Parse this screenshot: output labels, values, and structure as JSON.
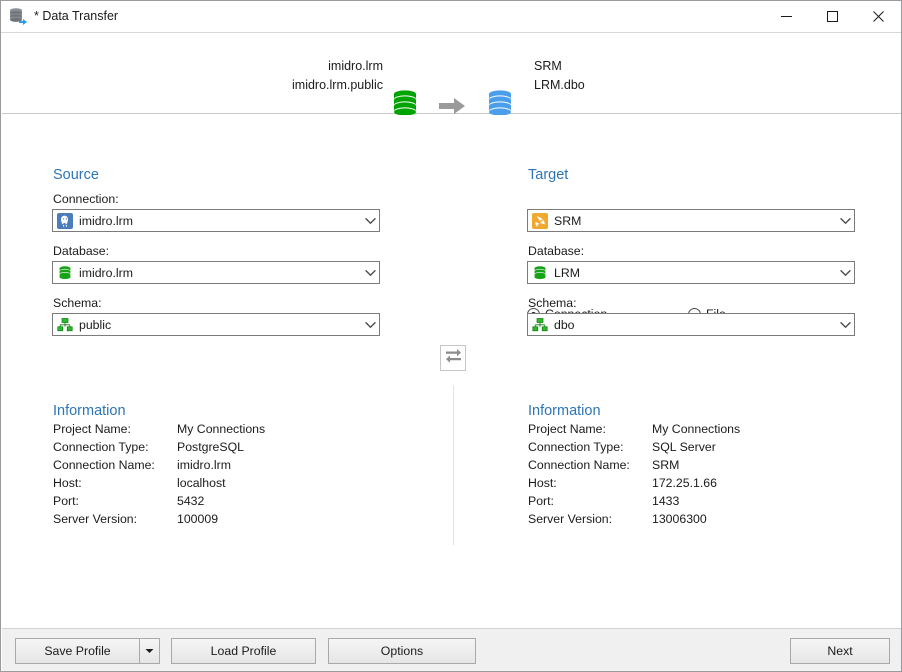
{
  "window": {
    "title": "* Data Transfer",
    "icon": "data-transfer-icon",
    "controls": {
      "minimize": "─",
      "maximize": "□",
      "close": "✕"
    }
  },
  "header": {
    "source_line1": "imidro.lrm",
    "source_line2": "imidro.lrm.public",
    "target_line1": "SRM",
    "target_line2": "LRM.dbo",
    "source_db_color": "#00a400",
    "target_db_color": "#4a9eea",
    "arrow_color": "#9a9a9a"
  },
  "source": {
    "title": "Source",
    "connection_label": "Connection:",
    "connection_value": "imidro.lrm",
    "connection_icon": "postgresql-icon",
    "database_label": "Database:",
    "database_value": "imidro.lrm",
    "database_icon": "database-icon",
    "schema_label": "Schema:",
    "schema_value": "public",
    "schema_icon": "schema-icon",
    "info_title": "Information",
    "info": [
      {
        "key": "Project Name:",
        "value": "My Connections"
      },
      {
        "key": "Connection Type:",
        "value": "PostgreSQL"
      },
      {
        "key": "Connection Name:",
        "value": "imidro.lrm"
      },
      {
        "key": "Host:",
        "value": "localhost"
      },
      {
        "key": "Port:",
        "value": "5432"
      },
      {
        "key": "Server Version:",
        "value": "100009"
      }
    ]
  },
  "target": {
    "title": "Target",
    "radio_connection": "Connection",
    "radio_file": "File",
    "radio_selected": "connection",
    "connection_value": "SRM",
    "connection_icon": "sqlserver-icon",
    "database_label": "Database:",
    "database_value": "LRM",
    "database_icon": "database-icon",
    "schema_label": "Schema:",
    "schema_value": "dbo",
    "schema_icon": "schema-icon",
    "info_title": "Information",
    "info": [
      {
        "key": "Project Name:",
        "value": "My Connections"
      },
      {
        "key": "Connection Type:",
        "value": "SQL Server"
      },
      {
        "key": "Connection Name:",
        "value": "SRM"
      },
      {
        "key": "Host:",
        "value": "172.25.1.66"
      },
      {
        "key": "Port:",
        "value": "1433"
      },
      {
        "key": "Server Version:",
        "value": "13006300"
      }
    ]
  },
  "swap": {
    "name": "swap-source-target",
    "icon": "swap-arrows-icon"
  },
  "footer": {
    "save_profile": "Save Profile",
    "load_profile": "Load Profile",
    "options": "Options",
    "next": "Next"
  },
  "colors": {
    "accent": "#2e75b6",
    "text": "#1b1b1b",
    "chrome": "#f0f0f0",
    "border": "#7b7b7b"
  }
}
